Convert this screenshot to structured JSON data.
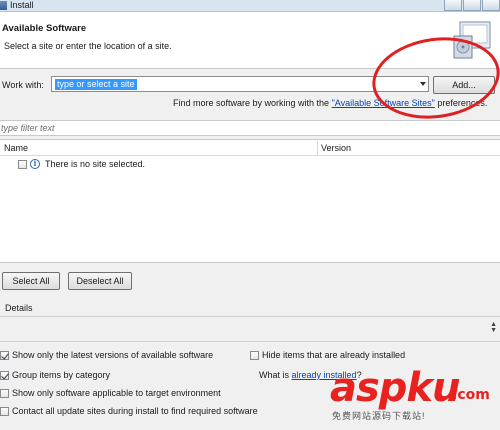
{
  "window": {
    "title": "Install",
    "icon": "eclipse-window-icon"
  },
  "header": {
    "title": "Available Software",
    "description": "Select a site or enter the location of a site.",
    "graphic": "install-wizard-banner-icon"
  },
  "work_with": {
    "label": "Work with:",
    "value": "type or select a site",
    "add_button": "Add...",
    "find_more_prefix": "Find more software by working with the ",
    "find_more_link": "\"Available Software Sites\"",
    "find_more_suffix": " preferences."
  },
  "filter": {
    "placeholder": "type filter text"
  },
  "table": {
    "columns": [
      "Name",
      "Version"
    ],
    "rows": [
      {
        "message": "There is no site selected.",
        "icon": "info-icon",
        "checked": false
      }
    ]
  },
  "buttons": {
    "select_all": "Select All",
    "deselect_all": "Deselect All"
  },
  "details": {
    "label": "Details"
  },
  "options": {
    "latest_versions": {
      "label": "Show only the latest versions of available software",
      "checked": true
    },
    "group_by_category": {
      "label": "Group items by category",
      "checked": true
    },
    "target_env": {
      "label": "Show only software applicable to target environment",
      "checked": false
    },
    "contact_sites": {
      "label": "Contact all update sites during install to find required software",
      "checked": false
    },
    "hide_installed": {
      "label": "Hide items that are already installed",
      "checked": false
    },
    "what_is_prefix": "What is ",
    "what_is_link": "already installed",
    "what_is_suffix": "?"
  },
  "watermark": {
    "brand": "aspku",
    "tld": ".com",
    "tagline": "免费网站源码下载站!"
  },
  "colors": {
    "annotation": "#e02020",
    "selection": "#3399ff",
    "link": "#0645ad",
    "watermark": "#e8231f"
  }
}
